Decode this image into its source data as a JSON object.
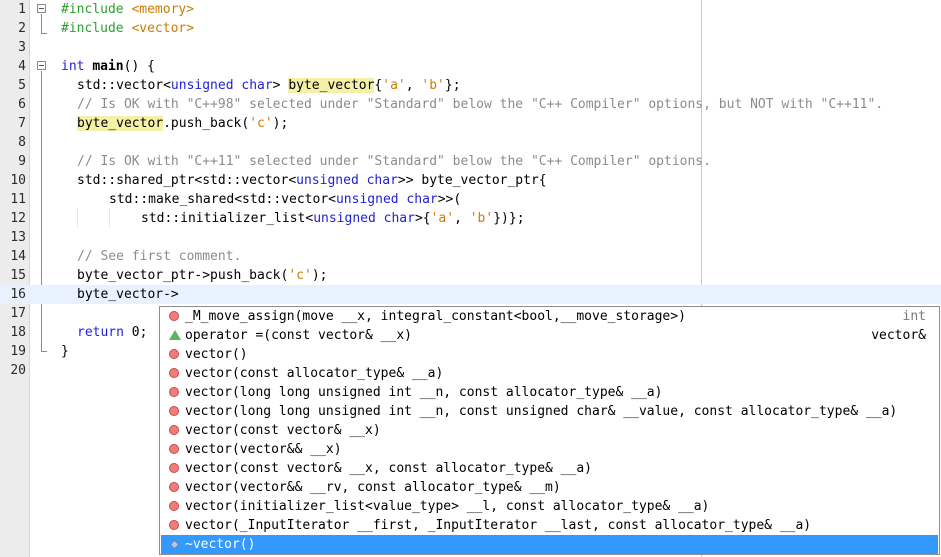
{
  "editor": {
    "line_numbers": [
      "1",
      "2",
      "3",
      "4",
      "5",
      "6",
      "7",
      "8",
      "9",
      "10",
      "11",
      "12",
      "13",
      "14",
      "15",
      "16",
      "17",
      "18",
      "19",
      "20"
    ],
    "l1_dir": "#include",
    "l1_file": "<memory>",
    "l2_dir": "#include",
    "l2_file": "<vector>",
    "l4_kw": "int",
    "l4_name": "main",
    "l4_rest": "() {",
    "l5_a": "std::vector<",
    "l5_kw": "unsigned char",
    "l5_b": "> ",
    "l5_var": "byte_vector",
    "l5_c": "{",
    "l5_s1": "'a'",
    "l5_d": ", ",
    "l5_s2": "'b'",
    "l5_e": "};",
    "l6_comment": "// Is OK with \"C++98\" selected under \"Standard\" below the \"C++ Compiler\" options, but NOT with \"C++11\".",
    "l7_var": "byte_vector",
    "l7_a": ".push_back(",
    "l7_s": "'c'",
    "l7_b": ");",
    "l9_comment": "// Is OK with \"C++11\" selected under \"Standard\" below the \"C++ Compiler\" options.",
    "l10_a": "std::shared_ptr<std::vector<",
    "l10_kw": "unsigned char",
    "l10_b": ">> byte_vector_ptr{",
    "l11_a": "std::make_shared<std::vector<",
    "l11_kw": "unsigned char",
    "l11_b": ">>(",
    "l12_a": "std::initializer_list<",
    "l12_kw": "unsigned char",
    "l12_b": ">{",
    "l12_s1": "'a'",
    "l12_c": ", ",
    "l12_s2": "'b'",
    "l12_d": "})};",
    "l14_comment": "// See first comment.",
    "l15_a": "byte_vector_ptr->push_back(",
    "l15_s": "'c'",
    "l15_b": ");",
    "l16_a": "byte_vector->",
    "l18_kw": "return",
    "l18_b": " 0;",
    "l19_a": "}"
  },
  "completion": {
    "items": [
      {
        "icon": "method-icon",
        "text": "_M_move_assign(move __x, integral_constant<bool,__move_storage>)",
        "ret": "int"
      },
      {
        "icon": "operator-icon",
        "text": "operator =(const vector& __x)",
        "ret": "vector&"
      },
      {
        "icon": "method-icon",
        "text": "vector()",
        "ret": ""
      },
      {
        "icon": "method-icon",
        "text": "vector(const allocator_type& __a)",
        "ret": ""
      },
      {
        "icon": "method-icon",
        "text": "vector(long long unsigned int __n, const allocator_type& __a)",
        "ret": ""
      },
      {
        "icon": "method-icon",
        "text": "vector(long long unsigned int __n, const unsigned char& __value, const allocator_type& __a)",
        "ret": ""
      },
      {
        "icon": "method-icon",
        "text": "vector(const vector& __x)",
        "ret": ""
      },
      {
        "icon": "method-icon",
        "text": "vector(vector&& __x)",
        "ret": ""
      },
      {
        "icon": "method-icon",
        "text": "vector(const vector& __x, const allocator_type& __a)",
        "ret": ""
      },
      {
        "icon": "method-icon",
        "text": "vector(vector&& __rv, const allocator_type& __m)",
        "ret": ""
      },
      {
        "icon": "method-icon",
        "text": "vector(initializer_list<value_type> __l, const allocator_type& __a)",
        "ret": ""
      },
      {
        "icon": "method-icon",
        "text": "vector(_InputIterator __first, _InputIterator __last, const allocator_type& __a)",
        "ret": ""
      },
      {
        "icon": "destructor-icon",
        "text": "~vector()",
        "ret": ""
      }
    ],
    "selected_index": 12
  },
  "colors": {
    "keyword": "#1f1fd6",
    "preprocessor": "#2e9e2e",
    "string": "#ce7b00",
    "comment": "#8c8c8c",
    "selection": "#3399ff",
    "highlight": "#f4f0a8"
  }
}
